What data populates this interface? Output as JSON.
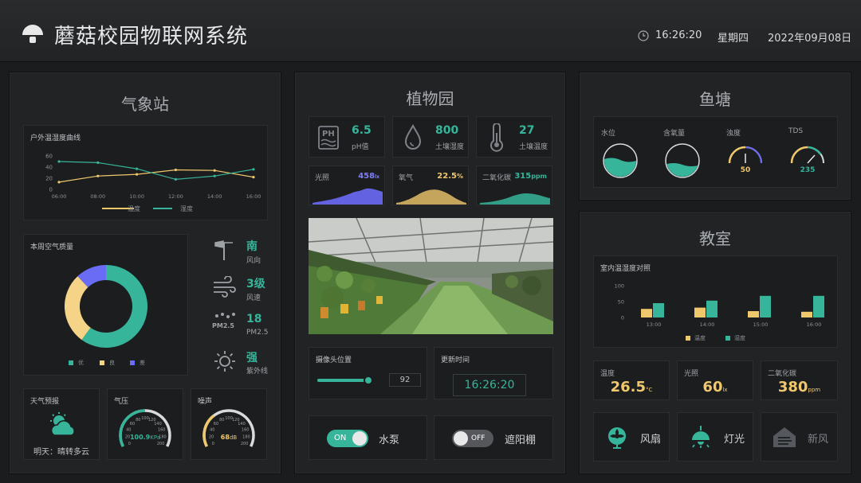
{
  "header": {
    "title": "蘑菇校园物联网系统",
    "time": "16:26:20",
    "weekday": "星期四",
    "date": "2022年09月08日"
  },
  "weather_station": {
    "title": "气象站",
    "temp_chart": {
      "title": "户外温湿度曲线",
      "legend": [
        "温度",
        "湿度"
      ],
      "chart_data": {
        "type": "line",
        "x": [
          "06:00",
          "08:00",
          "10:00",
          "12:00",
          "14:00",
          "16:00"
        ],
        "yticks": [
          "60",
          "40",
          "20",
          "0"
        ],
        "ylim": [
          0,
          60
        ],
        "series": [
          {
            "name": "温度",
            "color": "#f0c86c",
            "values": [
              13,
              24,
              27,
              35,
              34,
              22
            ]
          },
          {
            "name": "湿度",
            "color": "#36b59a",
            "values": [
              50,
              48,
              37,
              18,
              24,
              36
            ]
          }
        ]
      }
    },
    "aqi": {
      "title": "本周空气质量",
      "legend": [
        "优",
        "良",
        "差"
      ],
      "chart_data": {
        "type": "pie",
        "labels": [
          "优",
          "良",
          "差"
        ],
        "values": [
          60,
          28,
          12
        ],
        "colors": [
          "#36b59a",
          "#f5d488",
          "#6b6cf6"
        ]
      }
    },
    "wind_dir": {
      "value": "南",
      "label": "风向"
    },
    "wind_speed": {
      "value": "3级",
      "label": "风速"
    },
    "pm25": {
      "value": "18",
      "label": "PM2.5",
      "icon_text": "PM2.5"
    },
    "uv": {
      "value": "强",
      "label": "紫外线"
    },
    "forecast": {
      "title": "天气预报",
      "text": "明天：晴转多云"
    },
    "pressure": {
      "title": "气压",
      "value": "100.9",
      "unit": "KPa",
      "ticks": [
        "0",
        "20",
        "40",
        "60",
        "80",
        "100",
        "120",
        "140",
        "160",
        "180",
        "200"
      ],
      "level": 0.5
    },
    "noise": {
      "title": "噪声",
      "value": "68",
      "unit": "dB",
      "ticks": [
        "0",
        "20",
        "40",
        "60",
        "80",
        "100",
        "120",
        "140",
        "160",
        "180",
        "200"
      ],
      "level": 0.34
    }
  },
  "garden": {
    "title": "植物园",
    "ph": {
      "icon_text": "PH",
      "value": "6.5",
      "label": "pH值"
    },
    "soil_moisture": {
      "value": "800",
      "label": "土壤湿度"
    },
    "soil_temp": {
      "value": "27",
      "label": "土壤温度"
    },
    "light": {
      "label": "光照",
      "value": "458",
      "unit": "lx",
      "color": "#6b6cf6"
    },
    "oxygen": {
      "label": "氧气",
      "value": "22.5",
      "unit": "%",
      "color": "#f0c86c"
    },
    "co2": {
      "label": "二氧化碳",
      "value": "315",
      "unit": "ppm",
      "color": "#36b59a"
    },
    "camera": {
      "title": "摄像头位置",
      "value": "92",
      "level": 0.92
    },
    "update": {
      "title": "更新时间",
      "time": "16:26:20"
    },
    "pump": {
      "state": "ON",
      "label": "水泵"
    },
    "shade": {
      "state": "OFF",
      "label": "遮阳棚"
    }
  },
  "pond": {
    "title": "鱼塘",
    "water_level": {
      "label": "水位",
      "level": 0.5
    },
    "oxygen": {
      "label": "含氧量",
      "level": 0.35
    },
    "turbidity": {
      "label": "浊度",
      "value": "50",
      "level": 0.5
    },
    "tds": {
      "label": "TDS",
      "value": "235",
      "level": 0.82
    }
  },
  "classroom": {
    "title": "教室",
    "chart": {
      "title": "室内温湿度对照",
      "legend": [
        "温度",
        "湿度"
      ],
      "chart_data": {
        "type": "bar",
        "categories": [
          "13:00",
          "14:00",
          "15:00",
          "16:00"
        ],
        "yticks": [
          "100",
          "50",
          "0"
        ],
        "ylim": [
          0,
          100
        ],
        "series": [
          {
            "name": "温度",
            "color": "#f0c86c",
            "values": [
              27,
              31,
              20,
              18
            ]
          },
          {
            "name": "湿度",
            "color": "#36b59a",
            "values": [
              45,
              53,
              68,
              68
            ]
          }
        ]
      }
    },
    "temp": {
      "label": "温度",
      "value": "26.5",
      "unit": "°C"
    },
    "light": {
      "label": "光照",
      "value": "60",
      "unit": "lx"
    },
    "co2": {
      "label": "二氧化碳",
      "value": "380",
      "unit": "ppm"
    },
    "fan": {
      "label": "风扇"
    },
    "lamp": {
      "label": "灯光"
    },
    "fresh_air": {
      "label": "新风"
    }
  }
}
